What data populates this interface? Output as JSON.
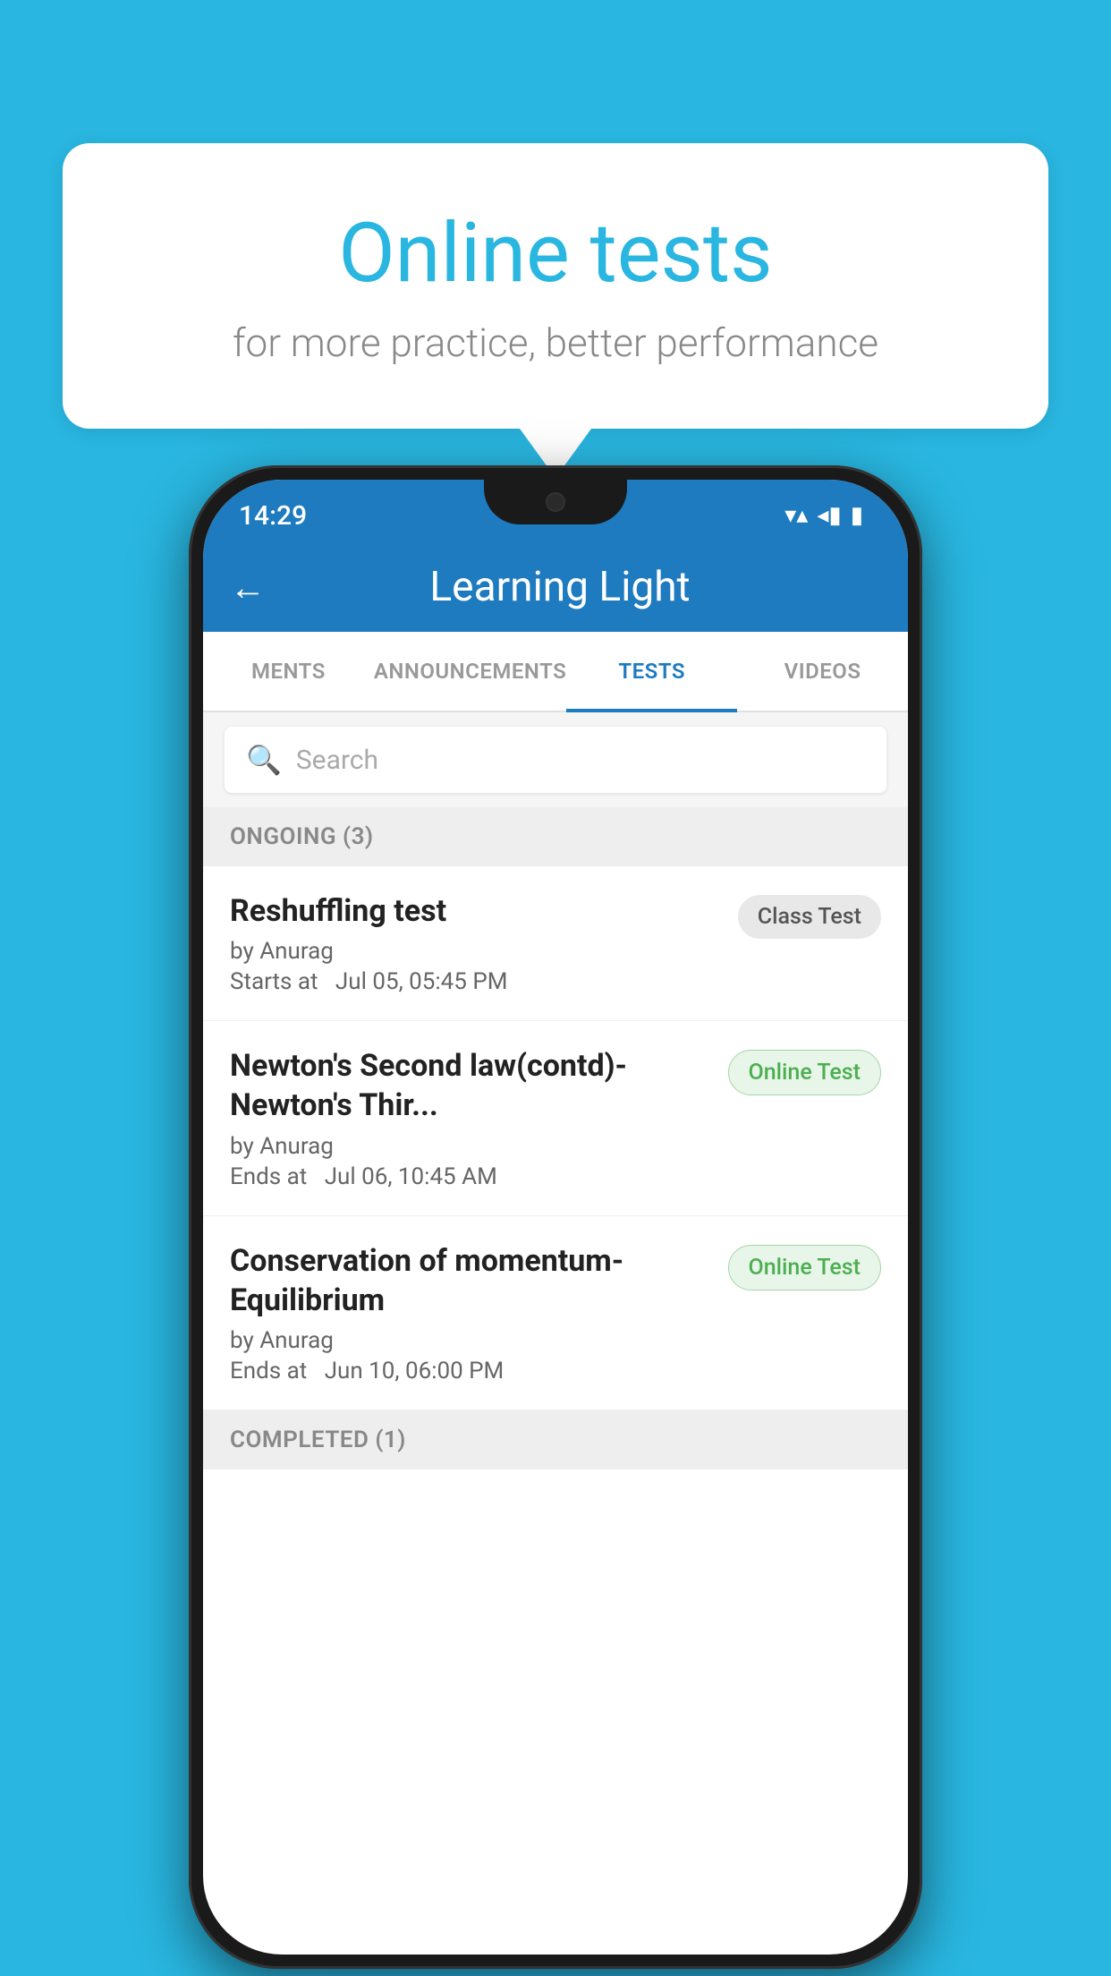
{
  "background_color": "#29b6e0",
  "speech_bubble": {
    "title": "Online tests",
    "subtitle": "for more practice, better performance"
  },
  "phone": {
    "status_bar": {
      "time": "14:29",
      "wifi": "▼",
      "signal": "◀",
      "battery": "▮"
    },
    "app_bar": {
      "back_label": "←",
      "title": "Learning Light"
    },
    "tabs": [
      {
        "label": "MENTS",
        "active": false
      },
      {
        "label": "ANNOUNCEMENTS",
        "active": false
      },
      {
        "label": "TESTS",
        "active": true
      },
      {
        "label": "VIDEOS",
        "active": false
      }
    ],
    "search": {
      "placeholder": "Search"
    },
    "ongoing_section": {
      "label": "ONGOING (3)"
    },
    "test_items": [
      {
        "title": "Reshuffling test",
        "author": "by Anurag",
        "date_label": "Starts at",
        "date": "Jul 05, 05:45 PM",
        "badge": "Class Test",
        "badge_type": "class"
      },
      {
        "title": "Newton's Second law(contd)-Newton's Thir...",
        "author": "by Anurag",
        "date_label": "Ends at",
        "date": "Jul 06, 10:45 AM",
        "badge": "Online Test",
        "badge_type": "online"
      },
      {
        "title": "Conservation of momentum-Equilibrium",
        "author": "by Anurag",
        "date_label": "Ends at",
        "date": "Jun 10, 06:00 PM",
        "badge": "Online Test",
        "badge_type": "online"
      }
    ],
    "completed_section": {
      "label": "COMPLETED (1)"
    }
  }
}
